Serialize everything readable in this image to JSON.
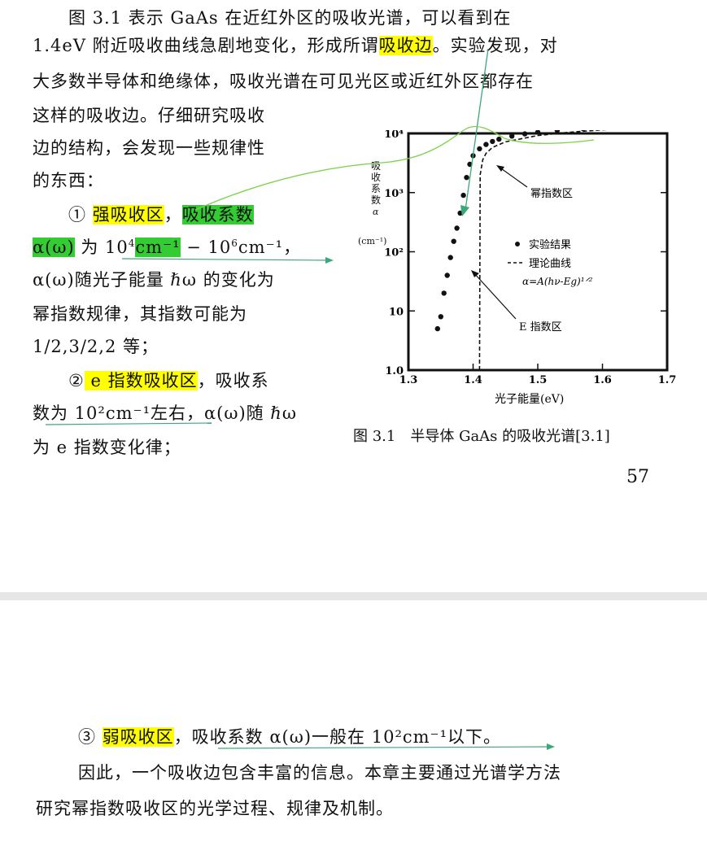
{
  "page1": {
    "lines": [
      "图 3.1 表示 GaAs 在近红外区的吸收光谱，可以看到在",
      "1.4eV 附近吸收曲线急剧地变化，形成所谓",
      "大多数半导体和绝缘体，吸收光谱在可见光区或近红外区都存在",
      "这样的吸收边。仔细研究吸收",
      "边的结构，会发现一些规律性",
      "的东西："
    ],
    "absorption_edge": "吸收边",
    "line2_tail": "。实验发现，对",
    "item1": {
      "marker": "①",
      "title": "强吸收区",
      "comma": "，",
      "coef_label": "吸收系数",
      "alpha": "α(ω)",
      "wei": " 为 10",
      "exp4": "4",
      "unit_hl": "cm⁻¹",
      "range_tail": " − 10",
      "exp6": "6",
      "unit_tail": "cm⁻¹，",
      "line3": "α(ω)随光子能量 ℏω 的变化为",
      "line4": "幂指数规律，其指数可能为",
      "line5": "1/2,3/2,2 等；"
    },
    "item2": {
      "marker": "②",
      "title": " e 指数吸收区",
      "tail": "，吸收系",
      "line2": "数为 10²cm⁻¹左右，α(ω)随 ℏω",
      "line3": "为 e 指数变化律；"
    },
    "page_number": "57",
    "figure": {
      "ylabel_lines": [
        "吸",
        "收",
        "系",
        "数",
        "α",
        "(cm⁻¹)"
      ],
      "y_ticks": [
        "10⁴",
        "10³",
        "10²",
        "10",
        "1.0"
      ],
      "x_ticks": [
        "1.3",
        "1.4",
        "1.5",
        "1.6",
        "1.7"
      ],
      "xlabel": "光子能量(eV)",
      "legend_exp": "实验结果",
      "legend_theory": "理论曲线",
      "formula": "α=A(hν-Eg)¹ᐟ²",
      "annot_power": "幂指数区",
      "annot_exp": "E 指数区"
    },
    "caption": "图 3.1　半导体 GaAs 的吸收光谱[3.1]"
  },
  "page2": {
    "item3_marker": "③",
    "item3_title": "弱吸收区",
    "item3_tail": "，吸收系数 α(ω)一般在 10²cm⁻¹以下。",
    "line2": "因此，一个吸收边包含丰富的信息。本章主要通过光谱学方法",
    "line3": "研究幂指数吸收区的光学过程、规律及机制。"
  },
  "chart_data": {
    "type": "scatter",
    "title": "半导体 GaAs 的吸收光谱",
    "xlabel": "光子能量(eV)",
    "ylabel": "吸收系数 α (cm⁻¹)",
    "xlim": [
      1.3,
      1.7
    ],
    "ylim": [
      1,
      10000
    ],
    "y_scale": "log",
    "series": [
      {
        "name": "实验结果",
        "style": "dots",
        "x": [
          1.345,
          1.35,
          1.355,
          1.36,
          1.365,
          1.37,
          1.375,
          1.38,
          1.385,
          1.39,
          1.395,
          1.4,
          1.41,
          1.42,
          1.43,
          1.44,
          1.46,
          1.48,
          1.5,
          1.53,
          1.57,
          1.61,
          1.65
        ],
        "y": [
          5,
          8,
          20,
          40,
          80,
          150,
          250,
          450,
          900,
          1800,
          3000,
          4200,
          5500,
          6500,
          7300,
          8000,
          9000,
          9800,
          10500,
          11200,
          12000,
          12600,
          13000
        ]
      },
      {
        "name": "理论曲线",
        "style": "dashed",
        "x": [
          1.41,
          1.411,
          1.415,
          1.42,
          1.43,
          1.45,
          1.5,
          1.55,
          1.6,
          1.65
        ],
        "y": [
          1,
          2000,
          3600,
          4600,
          5800,
          7200,
          9200,
          10500,
          11500,
          12500
        ]
      }
    ],
    "annotations": [
      "幂指数区",
      "E 指数区"
    ]
  }
}
